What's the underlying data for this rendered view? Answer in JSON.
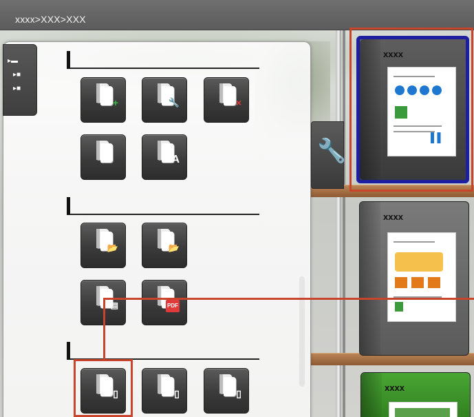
{
  "window": {
    "breadcrumb": "xxxx>XXX>XXX"
  },
  "folder_tree": {
    "items": [
      "▸▬",
      "▸■",
      "▸■"
    ]
  },
  "sections": [
    {
      "label": ""
    },
    {
      "label": ""
    },
    {
      "label": ""
    }
  ],
  "tools": {
    "row1": [
      {
        "icon": "add-binder-icon",
        "badge": "+",
        "badge_color": "#3ab54a"
      },
      {
        "icon": "binder-settings-icon",
        "badge": "🔧",
        "badge_color": "#f2b01e"
      },
      {
        "icon": "delete-binder-icon",
        "badge": "×",
        "badge_color": "#e03a3a"
      }
    ],
    "row2": [
      {
        "icon": "duplicate-binder-icon",
        "badge": ""
      },
      {
        "icon": "rename-binder-icon",
        "badge": "A",
        "badge_color": "#ffffff"
      }
    ],
    "row3": [
      {
        "icon": "import-folder-icon",
        "badge": "📂",
        "badge_color": "#f4c46c"
      },
      {
        "icon": "export-folder-icon",
        "badge": "📂",
        "badge_color": "#f4c46c"
      }
    ],
    "row4": [
      {
        "icon": "import-document-icon",
        "badge": "▤",
        "badge_color": "#ffffff"
      },
      {
        "icon": "export-pdf-icon",
        "badge": "PDF",
        "badge_color": "#e03a3a"
      }
    ],
    "row5": [
      {
        "icon": "import-to-device-icon",
        "badge": "▯",
        "badge_color": "#ffffff"
      },
      {
        "icon": "export-to-device-icon",
        "badge": "▯",
        "badge_color": "#ffffff"
      },
      {
        "icon": "sync-device-icon",
        "badge": "▯",
        "badge_color": "#ffffff"
      }
    ]
  },
  "shelf": {
    "binders": [
      {
        "title": "xxxx",
        "color": "#4d4d4d",
        "selected": true
      },
      {
        "title": "xxxx",
        "color": "#6a6a6a",
        "selected": false
      },
      {
        "title": "xxxx",
        "color": "#3c8f2a",
        "selected": false
      }
    ]
  },
  "colors": {
    "highlight": "#c8452c",
    "selection_border": "#1d1fa0"
  }
}
